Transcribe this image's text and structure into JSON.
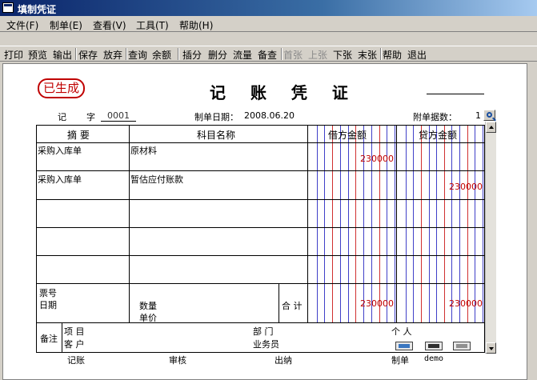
{
  "window": {
    "title": "填制凭证"
  },
  "menu": [
    "文件(F)",
    "制单(E)",
    "查看(V)",
    "工具(T)",
    "帮助(H)"
  ],
  "toolbar": {
    "buttons": [
      {
        "label": "打印"
      },
      {
        "label": "预览"
      },
      {
        "label": "输出"
      },
      {
        "label": "保存"
      },
      {
        "label": "放弃"
      },
      {
        "label": "查询"
      },
      {
        "label": "余额"
      },
      {
        "label": "插分"
      },
      {
        "label": "删分"
      },
      {
        "label": "流量"
      },
      {
        "label": "备查"
      },
      {
        "label": "首张",
        "disabled": true
      },
      {
        "label": "上张",
        "disabled": true
      },
      {
        "label": "下张"
      },
      {
        "label": "末张"
      },
      {
        "label": "帮助"
      },
      {
        "label": "退出"
      }
    ]
  },
  "voucher": {
    "stamp": "已生成",
    "title": "记 账 凭 证",
    "type_label": "记",
    "number_label": "字",
    "number": "0001",
    "date_label": "制单日期：",
    "date": "2008.06.20",
    "attachments_label": "附单据数：",
    "attachments": "1",
    "columns": {
      "summary": "摘 要",
      "account": "科目名称",
      "debit": "借方金额",
      "credit": "贷方金额"
    },
    "rows": [
      {
        "summary": "采购入库单",
        "account": "原材料",
        "debit": "230000",
        "credit": ""
      },
      {
        "summary": "采购入库单",
        "account": "暂估应付账款",
        "debit": "",
        "credit": "230000"
      }
    ],
    "bottom": {
      "bill_no_label": "票号",
      "date_label": "日期",
      "qty_label": "数量",
      "price_label": "单价",
      "total_label": "合 计",
      "debit_total": "230000",
      "credit_total": "230000"
    },
    "notes": {
      "label": "备注",
      "project_label": "项 目",
      "dept_label": "部 门",
      "person_label": "个 人",
      "customer_label": "客 户",
      "salesperson_label": "业务员"
    },
    "signatures": {
      "bookkeeper_label": "记账",
      "auditor_label": "审核",
      "cashier_label": "出纳",
      "maker_label": "制单",
      "maker": "demo"
    }
  },
  "icons": [
    "app-icon",
    "magnifier-icon",
    "card-icon",
    "monitor-icon",
    "keyboard-icon",
    "scroll-up-icon",
    "scroll-down-icon"
  ]
}
